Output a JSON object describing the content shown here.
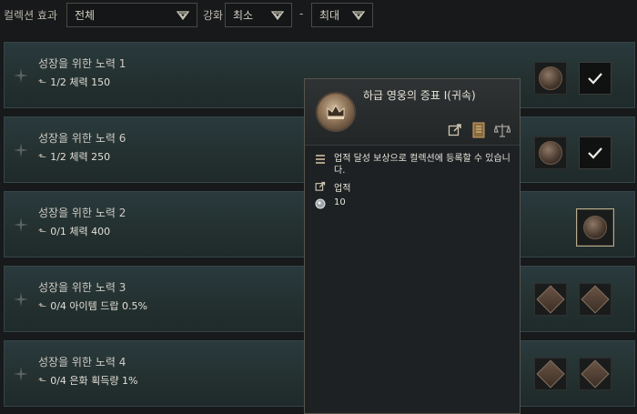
{
  "filters": {
    "collection_effect_label": "컬렉션 효과",
    "collection_effect_value": "전체",
    "enhance_label": "강화",
    "min_value": "최소",
    "range_dash": "-",
    "max_value": "최대"
  },
  "rows": [
    {
      "name": "성장을 위한 노력 1",
      "arrow": "⬑",
      "stat": "1/2 체력 150"
    },
    {
      "name": "성장을 위한 노력 6",
      "arrow": "⬑",
      "stat": "1/2 체력 250"
    },
    {
      "name": "성장을 위한 노력 2",
      "arrow": "⬑",
      "stat": "0/1 체력 400"
    },
    {
      "name": "성장을 위한 노력 3",
      "arrow": "⬑",
      "stat": "0/4 아이템 드랍 0.5%"
    },
    {
      "name": "성장을 위한 노력 4",
      "arrow": "⬑",
      "stat": "0/4 은화 획득량 1%"
    }
  ],
  "tooltip": {
    "title": "하급 영웅의 증표 I(귀속)",
    "description": "업적 달성 보상으로 컬렉션에 등록할 수 있습니다.",
    "source_label": "업적",
    "count": "10"
  },
  "colors": {
    "accent_gold": "#b7aa8b",
    "row_bg": "#2a3a3d",
    "tooltip_bg": "#1e2123"
  },
  "icons": {
    "chevron": "chevron-down-icon",
    "star": "compass-star-icon",
    "check": "check-icon",
    "link": "link-icon",
    "book": "book-icon",
    "scale": "scale-icon",
    "list": "list-icon",
    "silver": "silver-coin-icon"
  }
}
